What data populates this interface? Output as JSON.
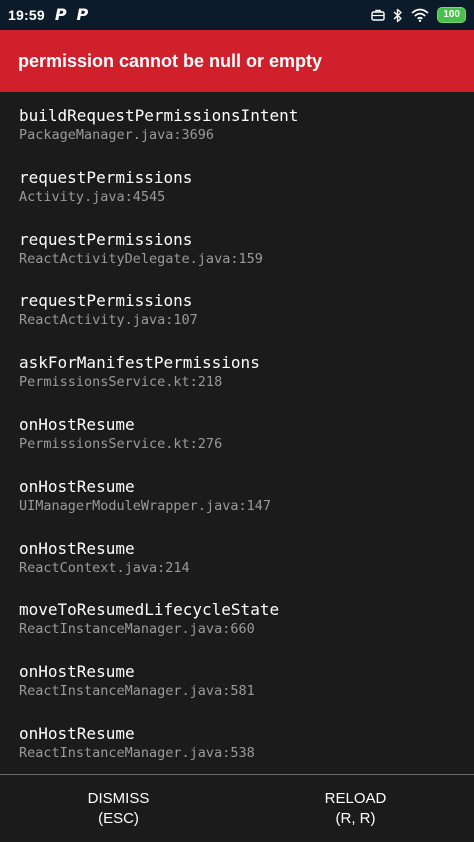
{
  "status_bar": {
    "time": "19:59",
    "notification_icons": [
      "P",
      "P"
    ],
    "battery": "100",
    "icons": [
      "briefcase-icon",
      "bluetooth-icon",
      "wifi-icon",
      "battery-icon"
    ]
  },
  "header": {
    "title": "permission cannot be null or empty",
    "background": "#d0202b"
  },
  "stack": [
    {
      "method": "buildRequestPermissionsIntent",
      "file": "PackageManager.java:3696"
    },
    {
      "method": "requestPermissions",
      "file": "Activity.java:4545"
    },
    {
      "method": "requestPermissions",
      "file": "ReactActivityDelegate.java:159"
    },
    {
      "method": "requestPermissions",
      "file": "ReactActivity.java:107"
    },
    {
      "method": "askForManifestPermissions",
      "file": "PermissionsService.kt:218"
    },
    {
      "method": "onHostResume",
      "file": "PermissionsService.kt:276"
    },
    {
      "method": "onHostResume",
      "file": "UIManagerModuleWrapper.java:147"
    },
    {
      "method": "onHostResume",
      "file": "ReactContext.java:214"
    },
    {
      "method": "moveToResumedLifecycleState",
      "file": "ReactInstanceManager.java:660"
    },
    {
      "method": "onHostResume",
      "file": "ReactInstanceManager.java:581"
    },
    {
      "method": "onHostResume",
      "file": "ReactInstanceManager.java:538"
    }
  ],
  "footer": {
    "dismiss_label": "DISMISS",
    "dismiss_shortcut": "(ESC)",
    "reload_label": "RELOAD",
    "reload_shortcut": "(R, R)"
  }
}
